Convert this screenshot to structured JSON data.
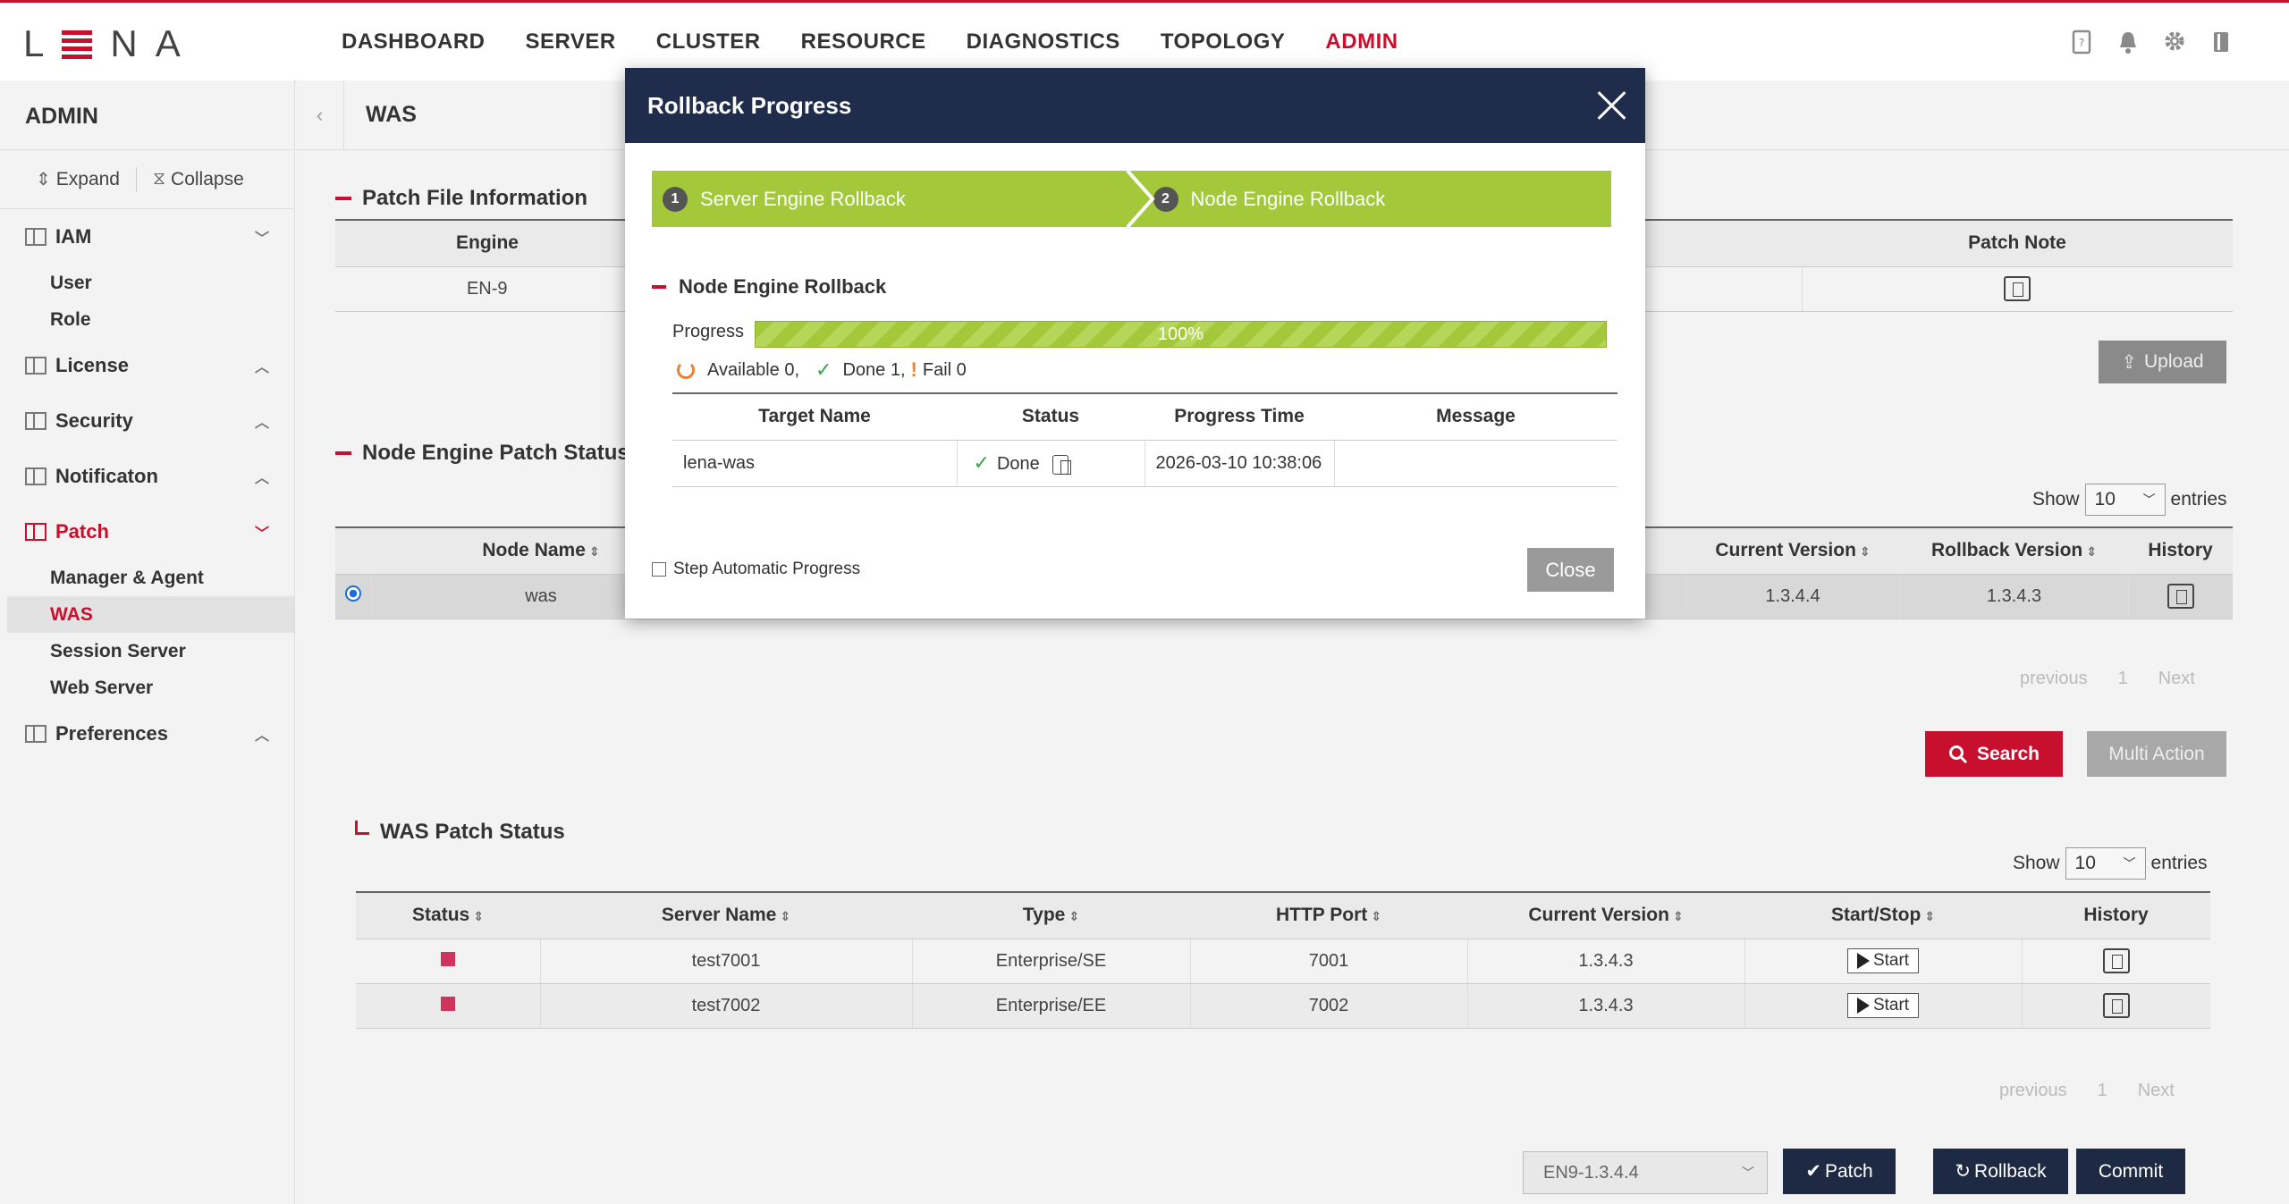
{
  "app": {
    "logo": "LENA",
    "nav": [
      "DASHBOARD",
      "SERVER",
      "CLUSTER",
      "RESOURCE",
      "DIAGNOSTICS",
      "TOPOLOGY",
      "ADMIN"
    ],
    "active_nav": "ADMIN",
    "top_icons": [
      "document-icon",
      "bell-icon",
      "gear-icon",
      "book-icon"
    ]
  },
  "sidebar": {
    "title": "ADMIN",
    "expand_label": "Expand",
    "collapse_label": "Collapse",
    "groups": [
      {
        "label": "IAM",
        "items": [
          "User",
          "Role"
        ]
      },
      {
        "label": "License",
        "items": []
      },
      {
        "label": "Security",
        "items": []
      },
      {
        "label": "Notificaton",
        "items": []
      },
      {
        "label": "Patch",
        "items": [
          "Manager & Agent",
          "WAS",
          "Session Server",
          "Web Server"
        ]
      },
      {
        "label": "Preferences",
        "items": []
      }
    ],
    "active_item": "WAS"
  },
  "main": {
    "page_title": "WAS",
    "patch_file": {
      "title": "Patch File Information",
      "headers": [
        "Engine",
        "Patch Note"
      ],
      "engine": "EN-9",
      "upload_label": "Upload"
    },
    "node_patch": {
      "title": "Node Engine Patch Status",
      "show_label": "Show",
      "show_value": "10",
      "entries_label": "entries",
      "headers": [
        "Node Name",
        "Current Version",
        "Rollback Version",
        "History"
      ],
      "row": {
        "node": "was",
        "current": "1.3.4.4",
        "rollback": "1.3.4.3"
      },
      "pager": {
        "previous": "previous",
        "page": "1",
        "next": "Next"
      },
      "search_label": "Search",
      "multi_action_label": "Multi Action"
    },
    "was_patch": {
      "title": "WAS Patch Status",
      "show_label": "Show",
      "show_value": "10",
      "entries_label": "entries",
      "headers": [
        "Status",
        "Server Name",
        "Type",
        "HTTP Port",
        "Current Version",
        "Start/Stop",
        "History"
      ],
      "rows": [
        {
          "server": "test7001",
          "type": "Enterprise/SE",
          "port": "7001",
          "version": "1.3.4.3",
          "action": "Start"
        },
        {
          "server": "test7002",
          "type": "Enterprise/EE",
          "port": "7002",
          "version": "1.3.4.3",
          "action": "Start"
        }
      ],
      "pager": {
        "previous": "previous",
        "page": "1",
        "next": "Next"
      }
    },
    "footer": {
      "version_select": "EN9-1.3.4.4",
      "patch_label": "Patch",
      "rollback_label": "Rollback",
      "commit_label": "Commit"
    }
  },
  "modal": {
    "title": "Rollback Progress",
    "steps": [
      {
        "num": "1",
        "label": "Server Engine Rollback"
      },
      {
        "num": "2",
        "label": "Node Engine Rollback"
      }
    ],
    "section_title": "Node Engine Rollback",
    "progress_label": "Progress",
    "progress_text": "100%",
    "progress_value": 100,
    "available_text": "Available 0,",
    "done_text": "Done 1,",
    "fail_text": "Fail 0",
    "headers": [
      "Target Name",
      "Status",
      "Progress Time",
      "Message"
    ],
    "row": {
      "target": "lena-was",
      "status": "Done",
      "time": "2026-03-10 10:38:06",
      "message": ""
    },
    "step_auto_label": "Step Automatic Progress",
    "close_label": "Close"
  }
}
